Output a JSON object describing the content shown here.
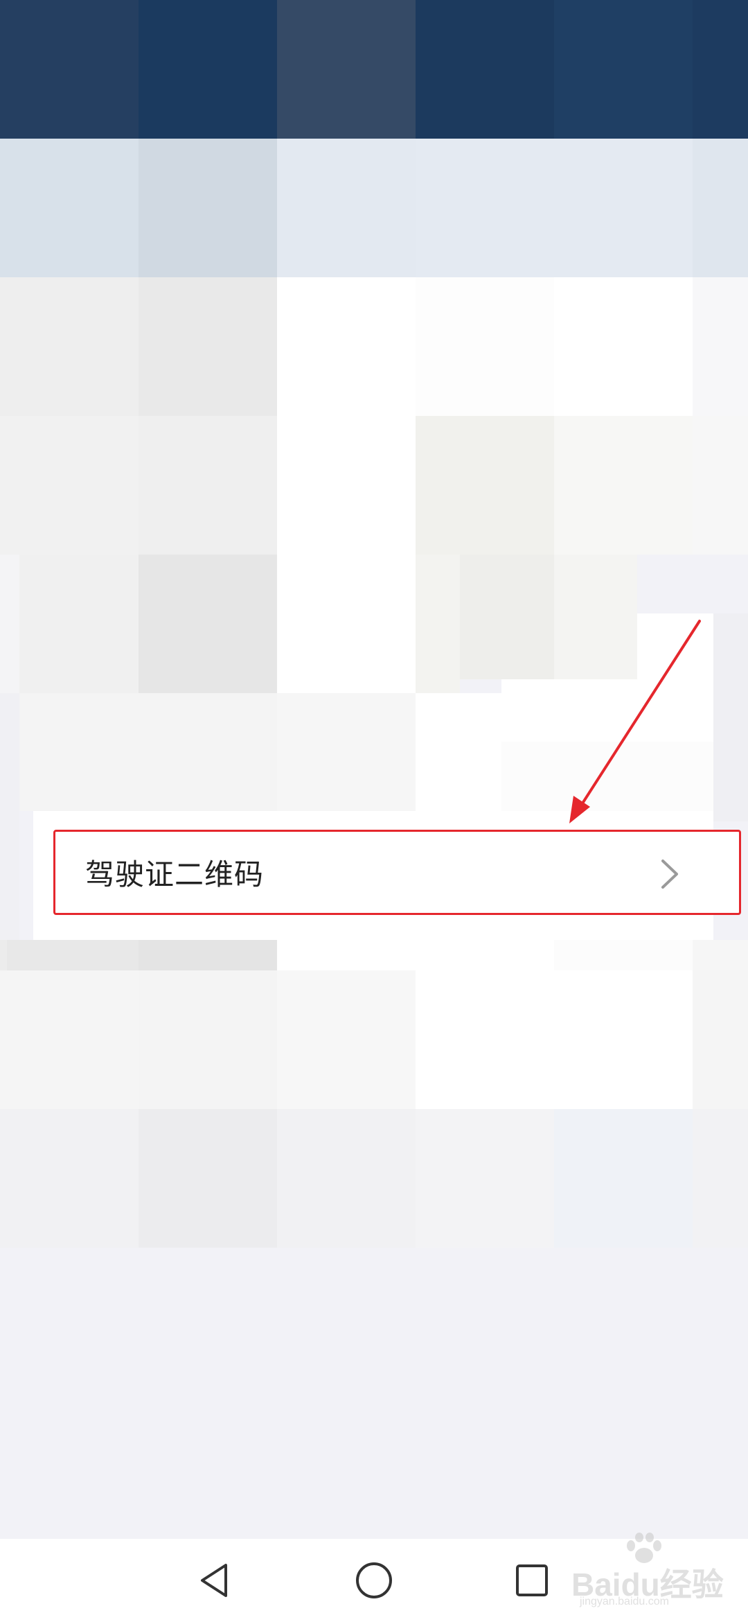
{
  "list": {
    "item_label": "驾驶证二维码"
  },
  "watermark": {
    "text": "Baidu经验",
    "sub": "jingyan.baidu.com"
  },
  "colors": {
    "highlight_border": "#e5272d",
    "annotation_arrow": "#e5272d",
    "background": "#f2f2f7",
    "header_dark": "#1f3d63"
  },
  "icons": {
    "chevron": "chevron-right-icon",
    "back": "back-triangle-icon",
    "home": "home-circle-icon",
    "recent": "recent-square-icon"
  }
}
